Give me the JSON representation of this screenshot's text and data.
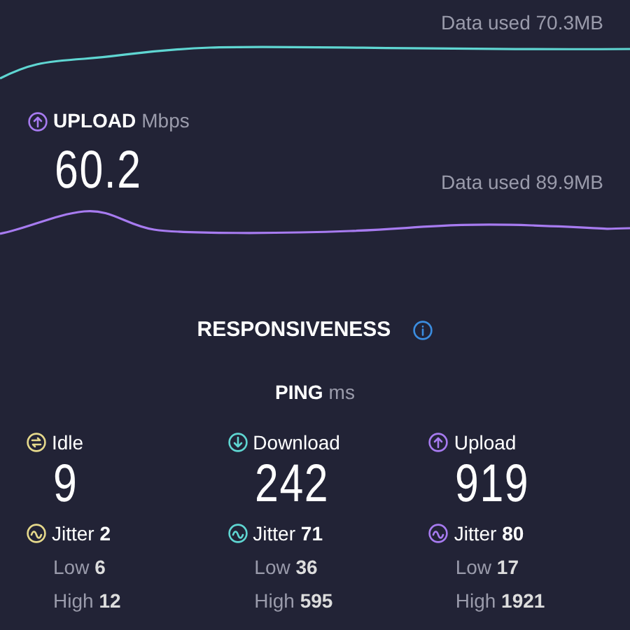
{
  "speed_sections": [
    {
      "kind": "download",
      "color": "#5fd6d2",
      "data_used": "Data used 70.3MB"
    },
    {
      "kind": "upload",
      "color": "#a77bf0",
      "label": "UPLOAD",
      "unit": "Mbps",
      "value": "60.2",
      "data_used": "Data used 89.9MB"
    }
  ],
  "responsiveness": {
    "title": "RESPONSIVENESS",
    "ping_label": "PING",
    "ping_unit": "ms",
    "columns": [
      {
        "kind": "idle",
        "color": "#e6d98c",
        "label": "Idle",
        "value": "9",
        "jitter": "Jitter **2**",
        "low": "Low **6**",
        "high": "High **12**"
      },
      {
        "kind": "download",
        "color": "#5fd6d2",
        "label": "Download",
        "value": "242",
        "jitter": "Jitter **71**",
        "low": "Low **36**",
        "high": "High **595**"
      },
      {
        "kind": "upload",
        "color": "#a77bf0",
        "label": "Upload",
        "value": "919",
        "jitter": "Jitter **80**",
        "low": "Low **17**",
        "high": "High **1921**"
      }
    ]
  }
}
